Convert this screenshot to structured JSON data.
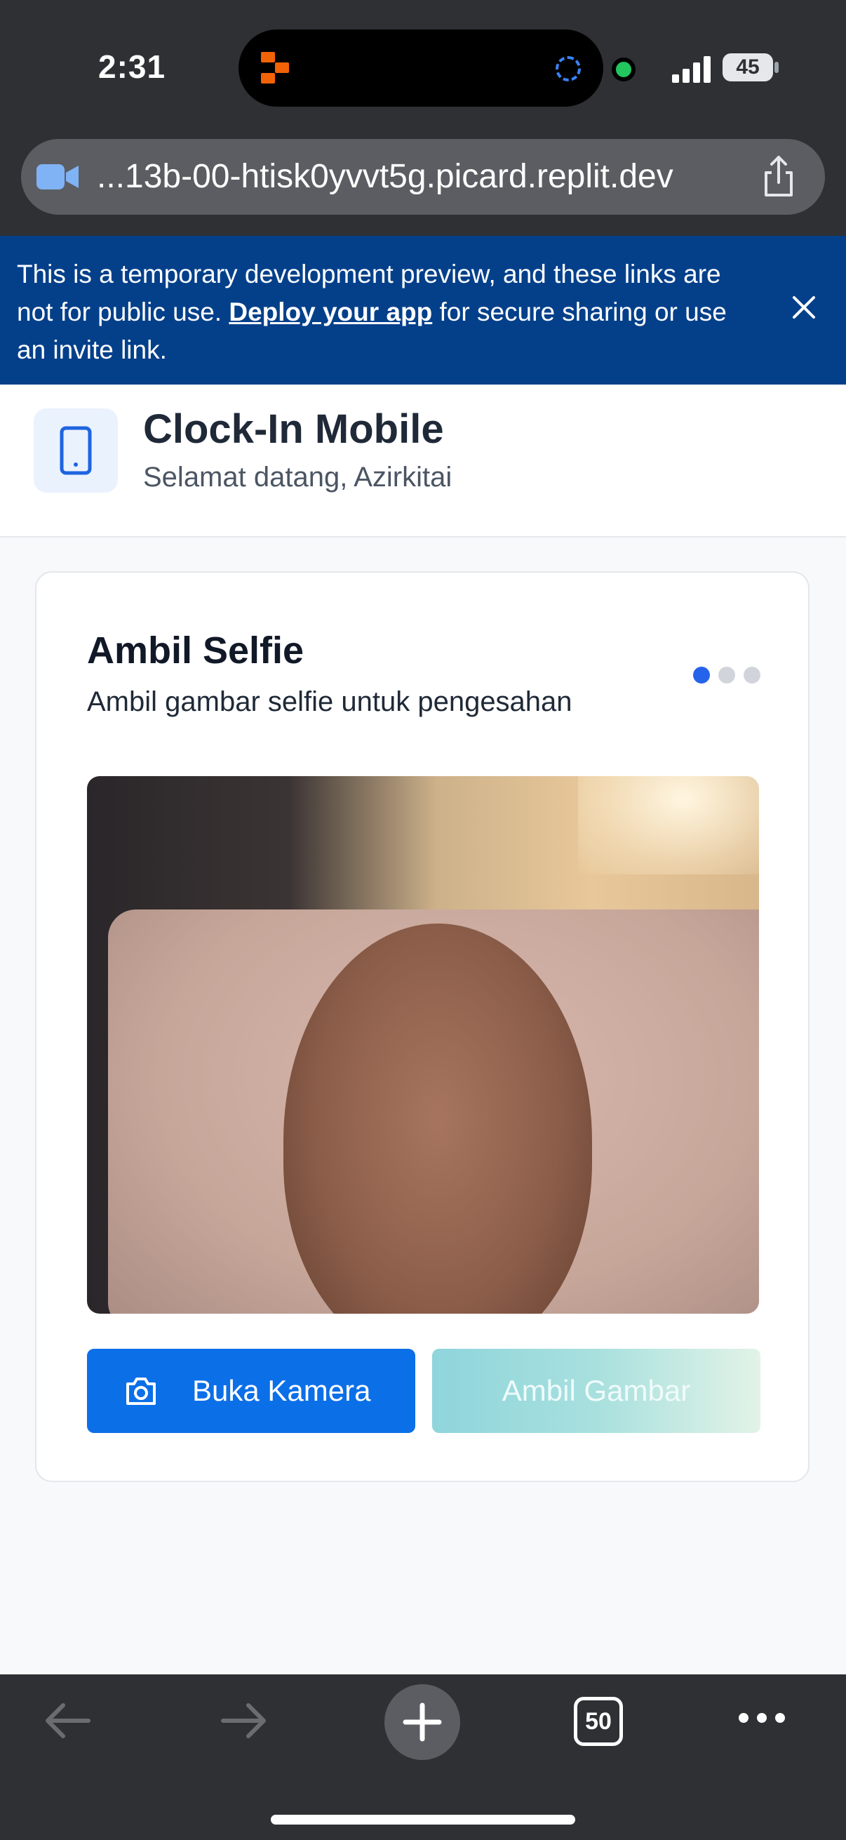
{
  "status_bar": {
    "time": "2:31",
    "battery": "45"
  },
  "browser": {
    "url": "...13b-00-htisk0yvvt5g.picard.replit.dev",
    "tab_count": "50"
  },
  "banner": {
    "text_before": "This is a temporary development preview, and these links are not for public use. ",
    "link": "Deploy your app",
    "text_after": " for secure sharing or use an invite link."
  },
  "header": {
    "title": "Clock-In Mobile",
    "subtitle": "Selamat datang, Azirkitai"
  },
  "card": {
    "title": "Ambil Selfie",
    "subtitle": "Ambil gambar selfie untuk pengesahan",
    "steps": {
      "total": 3,
      "active": 1
    },
    "open_camera_label": "Buka Kamera",
    "capture_label": "Ambil Gambar"
  },
  "colors": {
    "primary": "#0b6fe8",
    "banner": "#04408a",
    "chrome": "#2f3034"
  }
}
